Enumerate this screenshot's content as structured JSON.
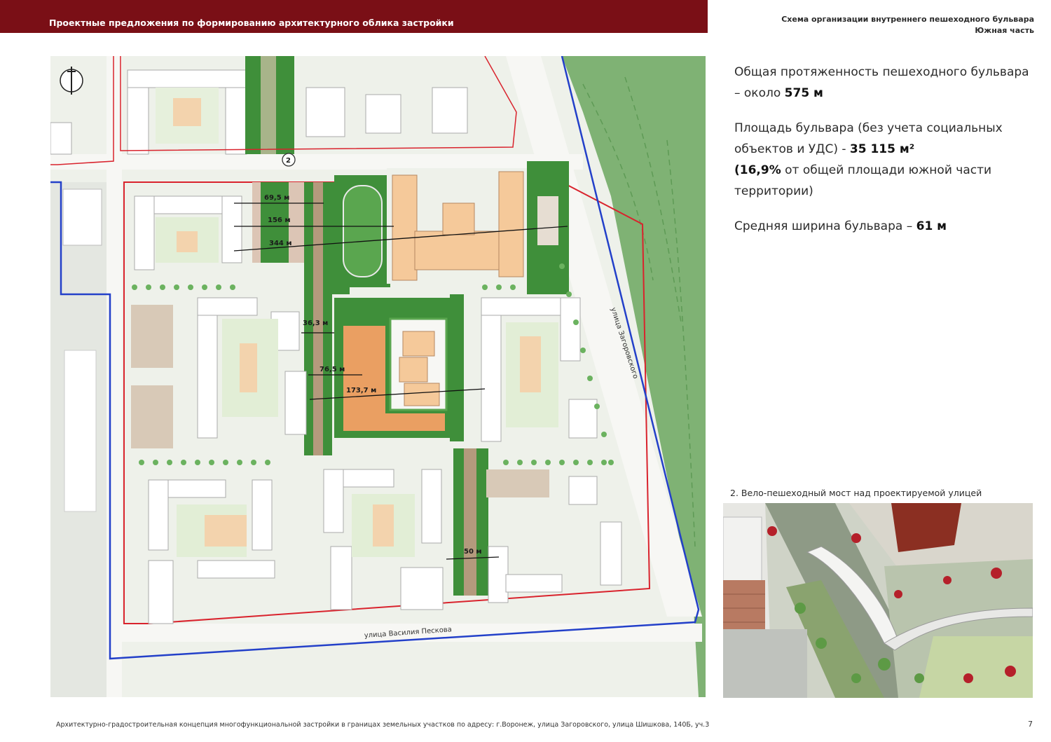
{
  "header": {
    "title": "Проектные предложения по формированию архитектурного облика застройки",
    "bar_color": "#7a0f16"
  },
  "scheme": {
    "line1": "Схема организации внутреннего пешеходного бульвара",
    "line2": "Южная часть"
  },
  "stats": {
    "length_text": "Общая протяженность  пешеходного бульвара – около ",
    "length_value": "575 м",
    "area_text": "Площадь бульвара (без учета социальных объектов и УДС) - ",
    "area_value": "35 115 м²",
    "area_share_value": "(16,9%",
    "area_share_text": " от общей площади южной части территории)",
    "width_text": "Средняя ширина бульвара – ",
    "width_value": "61 м"
  },
  "map": {
    "north_icon": "north-arrow-icon",
    "marker_label": "2",
    "dimensions": [
      "69,5 м",
      "156 м",
      "344 м",
      "36,3 м",
      "76,5 м",
      "173,7 м",
      "50 м"
    ],
    "streets": {
      "zagorovskogo": "улица Загоровского",
      "peskova": "улица Василия Пескова"
    },
    "colors": {
      "boundary_red": "#d9232d",
      "boundary_blue": "#2340c9",
      "greenery": "#3f8f3a",
      "school": "#f5c99a",
      "forest": "#7fb274"
    }
  },
  "photo": {
    "caption": "2. Вело-пешеходный мост над проектируемой улицей"
  },
  "footer": {
    "text": "Архитектурно-градостроительная концепция многофункциональной застройки в границах земельных участков по адресу: г.Воронеж, улица Загоровского, улица Шишкова, 140Б, уч.3",
    "page": "7"
  }
}
